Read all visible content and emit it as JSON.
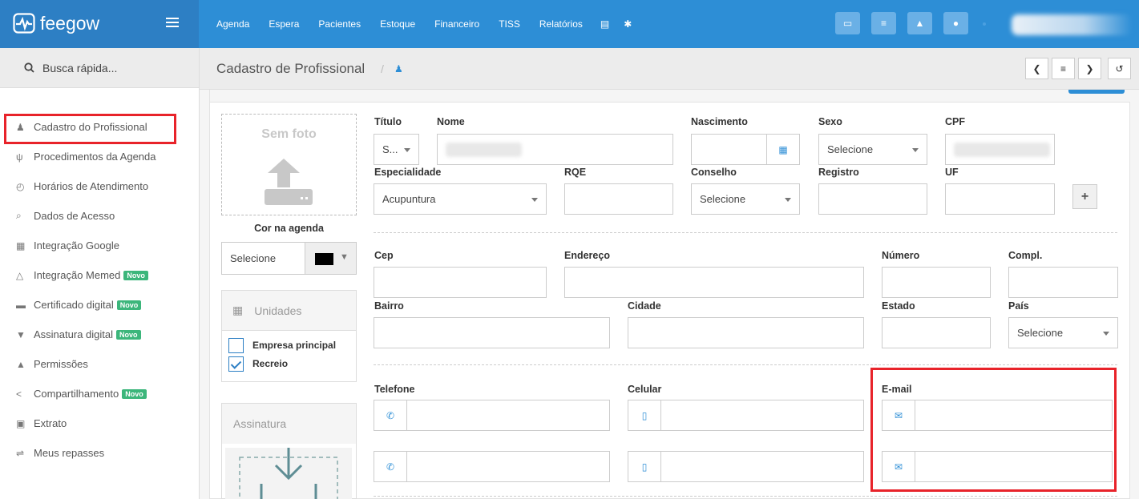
{
  "brand": {
    "name": "feegow"
  },
  "topnav": {
    "items": [
      "Agenda",
      "Espera",
      "Pacientes",
      "Estoque",
      "Financeiro",
      "TISS",
      "Relatórios"
    ]
  },
  "sidebar": {
    "search_label": "Busca rápida...",
    "items": [
      {
        "label": "Cadastro do Profissional",
        "icon": "user-md-icon",
        "badge": ""
      },
      {
        "label": "Procedimentos da Agenda",
        "icon": "stethoscope-icon",
        "badge": ""
      },
      {
        "label": "Horários de Atendimento",
        "icon": "clock-icon",
        "badge": ""
      },
      {
        "label": "Dados de Acesso",
        "icon": "key-icon",
        "badge": ""
      },
      {
        "label": "Integração Google",
        "icon": "calendar-icon",
        "badge": ""
      },
      {
        "label": "Integração Memed",
        "icon": "flask-icon",
        "badge": "Novo"
      },
      {
        "label": "Certificado digital",
        "icon": "credit-card-icon",
        "badge": "Novo"
      },
      {
        "label": "Assinatura digital",
        "icon": "shield-icon",
        "badge": "Novo"
      },
      {
        "label": "Permissões",
        "icon": "lock-icon",
        "badge": ""
      },
      {
        "label": "Compartilhamento",
        "icon": "share-icon",
        "badge": "Novo"
      },
      {
        "label": "Extrato",
        "icon": "money-icon",
        "badge": ""
      },
      {
        "label": "Meus repasses",
        "icon": "exchange-icon",
        "badge": ""
      }
    ]
  },
  "header": {
    "title": "Cadastro de Profissional",
    "separator": "/"
  },
  "photo": {
    "text": "Sem foto"
  },
  "cor": {
    "label": "Cor na agenda",
    "value": "Selecione",
    "swatch": "#000000"
  },
  "unidades": {
    "title": "Unidades",
    "options": [
      {
        "label": "Empresa principal",
        "checked": false
      },
      {
        "label": "Recreio",
        "checked": true
      }
    ]
  },
  "assinatura": {
    "title": "Assinatura"
  },
  "form": {
    "titulo_label": "Título",
    "titulo_value": "S...",
    "nome_label": "Nome",
    "nascimento_label": "Nascimento",
    "sexo_label": "Sexo",
    "sexo_value": "Selecione",
    "cpf_label": "CPF",
    "especialidade_label": "Especialidade",
    "especialidade_value": "Acupuntura",
    "rqe_label": "RQE",
    "conselho_label": "Conselho",
    "conselho_value": "Selecione",
    "registro_label": "Registro",
    "uf_label": "UF",
    "add_label": "+",
    "cep_label": "Cep",
    "endereco_label": "Endereço",
    "numero_label": "Número",
    "compl_label": "Compl.",
    "bairro_label": "Bairro",
    "cidade_label": "Cidade",
    "estado_label": "Estado",
    "pais_label": "País",
    "pais_value": "Selecione",
    "telefone_label": "Telefone",
    "celular_label": "Celular",
    "email_label": "E-mail"
  },
  "colors": {
    "accent": "#2d8ed6",
    "highlight": "#e8232a",
    "badge": "#3cb67b"
  }
}
